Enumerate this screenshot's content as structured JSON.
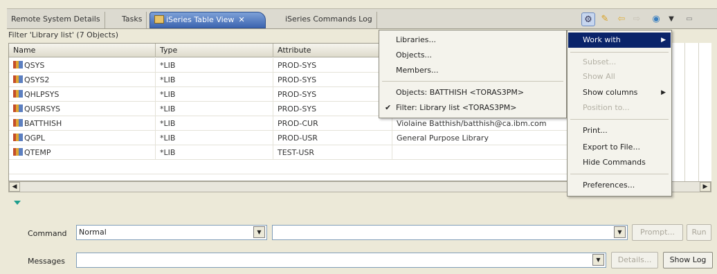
{
  "tabs": [
    {
      "label": "Remote System Details"
    },
    {
      "label": "Tasks"
    },
    {
      "label": "iSeries Table View"
    },
    {
      "label": "iSeries Commands Log"
    }
  ],
  "filter_label": "Filter 'Library list' (7 Objects)",
  "table": {
    "columns": [
      "Name",
      "Type",
      "Attribute",
      ""
    ],
    "rows": [
      {
        "name": "QSYS",
        "type": "*LIB",
        "attribute": "PROD-SYS",
        "text": ""
      },
      {
        "name": "QSYS2",
        "type": "*LIB",
        "attribute": "PROD-SYS",
        "text": ""
      },
      {
        "name": "QHLPSYS",
        "type": "*LIB",
        "attribute": "PROD-SYS",
        "text": ""
      },
      {
        "name": "QUSRSYS",
        "type": "*LIB",
        "attribute": "PROD-SYS",
        "text": ""
      },
      {
        "name": "BATTHISH",
        "type": "*LIB",
        "attribute": "PROD-CUR",
        "text": "Violaine Batthish/batthish@ca.ibm.com"
      },
      {
        "name": "QGPL",
        "type": "*LIB",
        "attribute": "PROD-USR",
        "text": "General Purpose Library"
      },
      {
        "name": "QTEMP",
        "type": "*LIB",
        "attribute": "TEST-USR",
        "text": ""
      }
    ]
  },
  "menu_view": {
    "items": [
      "Libraries...",
      "Objects...",
      "Members..."
    ],
    "filters": [
      "Objects: BATTHISH <TORAS3PM>",
      "Filter: Library list <TORAS3PM>"
    ],
    "checked_index": 1
  },
  "menu_actions": {
    "work_with": "Work with",
    "subset": "Subset...",
    "show_all": "Show All",
    "show_columns": "Show columns",
    "position_to": "Position to...",
    "print": "Print...",
    "export": "Export to File...",
    "hide_commands": "Hide Commands",
    "preferences": "Preferences..."
  },
  "command": {
    "label": "Command",
    "mode_value": "Normal",
    "command_value": "",
    "prompt_label": "Prompt...",
    "run_label": "Run"
  },
  "messages": {
    "label": "Messages",
    "value": "",
    "details_label": "Details...",
    "show_log_label": "Show Log"
  },
  "colors": {
    "menu_highlight": "#0a246a",
    "active_tab": "#3b64b0",
    "window_bg": "#ece9d8"
  }
}
